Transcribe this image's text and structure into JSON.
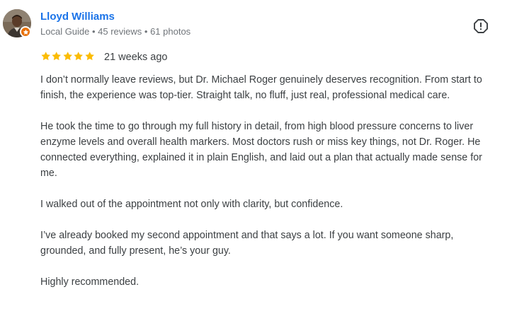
{
  "reviewer": {
    "name": "Lloyd Williams",
    "meta": "Local Guide • 45 reviews • 61 photos",
    "avatar_icon": "person-avatar",
    "badge_icon": "local-guide-star-icon",
    "badge_color": "#e8710a"
  },
  "actions": {
    "report_icon": "report-icon"
  },
  "rating": {
    "stars": 5,
    "max": 5,
    "star_color": "#fbbc04"
  },
  "time_ago": "21 weeks ago",
  "paragraphs": [
    "I don’t normally leave reviews, but Dr. Michael Roger genuinely deserves recognition. From start to finish, the experience was top-tier. Straight talk, no fluff, just real, professional medical care.",
    "He took the time to go through my full history in detail, from high blood pressure concerns to liver enzyme levels and overall health markers. Most doctors rush or miss key things, not Dr. Roger. He connected everything, explained it in plain English, and laid out a plan that actually made sense for me.",
    "I walked out of the appointment not only with clarity, but confidence.",
    "I’ve already booked my second appointment and that says a lot. If you want someone sharp, grounded, and fully present, he’s your guy.",
    "Highly recommended."
  ],
  "colors": {
    "name_link": "#1a73e8",
    "meta_text": "#70757a",
    "body_text": "#3c4043"
  }
}
